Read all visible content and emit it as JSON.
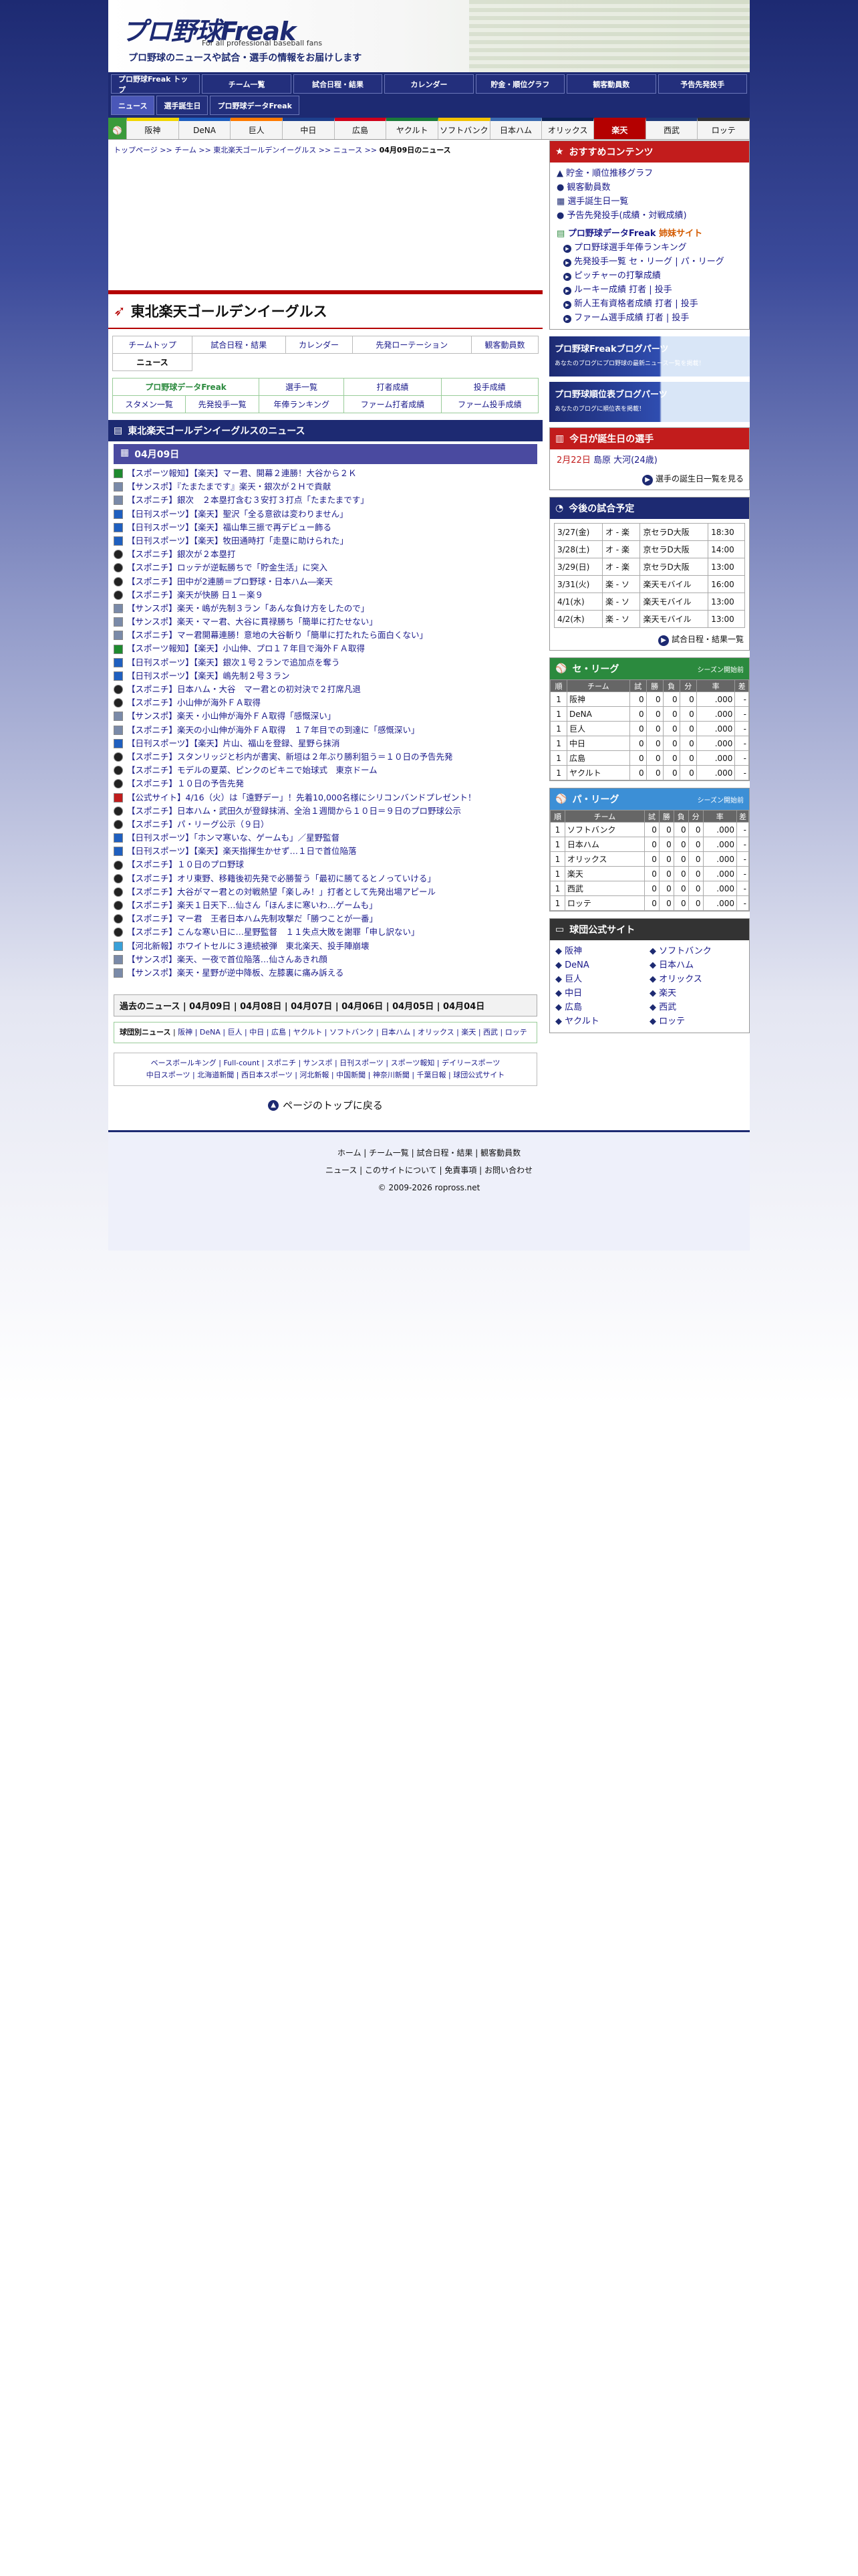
{
  "header": {
    "logo": "プロ野球Freak",
    "subtitle": "For all professional baseball fans",
    "tagline": "プロ野球のニュースや試合・選手の情報をお届けします"
  },
  "nav": {
    "row1": [
      "プロ野球Freak トップ",
      "チーム一覧",
      "試合日程・結果",
      "カレンダー",
      "貯金・順位グラフ",
      "観客動員数",
      "予告先発投手"
    ],
    "row2": [
      "ニュース",
      "選手誕生日",
      "プロ野球データFreak"
    ]
  },
  "teams": [
    "阪神",
    "DeNA",
    "巨人",
    "中日",
    "広島",
    "ヤクルト",
    "ソフトバンク",
    "日本ハム",
    "オリックス",
    "楽天",
    "西武",
    "ロッテ"
  ],
  "breadcrumb": {
    "path": "トップページ >> チーム >> 東北楽天ゴールデンイーグルス >> ニュース >> ",
    "current": "04月09日のニュース"
  },
  "page_title": "東北楽天ゴールデンイーグルス",
  "tabs": {
    "row1": [
      "チームトップ",
      "試合日程・結果",
      "カレンダー",
      "先発ローテーション",
      "観客動員数"
    ],
    "row2": [
      "ニュース"
    ],
    "row3": [
      "プロ野球データFreak",
      "選手一覧",
      "打者成績",
      "投手成績"
    ],
    "row4": [
      "スタメン一覧",
      "先発投手一覧",
      "年俸ランキング",
      "ファーム打者成績",
      "ファーム投手成績"
    ]
  },
  "news_section": "東北楽天ゴールデンイーグルスのニュース",
  "news_date": "04月09日",
  "news": [
    "【スポーツ報知】【楽天】マー君、開幕２連勝！大谷から２Ｋ",
    "【サンスポ】『たまたまです』楽天・銀次が２Ｈで貢献",
    "【スポニチ】銀次　２本塁打含む３安打３打点「たまたまです」",
    "【日刊スポーツ】【楽天】聖沢「全る意欲は変わりません」",
    "【日刊スポーツ】【楽天】福山隼三振で再デビュー飾る",
    "【日刊スポーツ】【楽天】牧田通時打「走塁に助けられた」",
    "【スポニチ】銀次が２本塁打",
    "【スポニチ】ロッテが逆転勝ちで「貯金生活」に突入",
    "【スポニチ】田中が2連勝＝プロ野球・日本ハム―楽天",
    "【スポニチ】楽天が快勝 日１－楽９",
    "【サンスポ】楽天・嶋が先制３ラン「あんな負け方をしたので」",
    "【サンスポ】楽天・マー君、大谷に貫禄勝ち「簡単に打たせない」",
    "【スポニチ】マー君開幕連勝！意地の大谷斬り「簡単に打たれたら面白くない」",
    "【スポーツ報知】【楽天】小山伸、プロ１７年目で海外ＦＡ取得",
    "【日刊スポーツ】【楽天】銀次１号２ランで追加点を奪う",
    "【日刊スポーツ】【楽天】嶋先制２号３ラン",
    "【スポニチ】日本ハム・大谷　マー君との初対決で２打席凡退",
    "【スポニチ】小山伸が海外ＦＡ取得",
    "【サンスポ】楽天・小山伸が海外ＦＡ取得「感慨深い」",
    "【スポニチ】楽天の小山伸が海外ＦＡ取得　１７年目での到達に「感慨深い」",
    "【日刊スポーツ】【楽天】片山、福山を登録、星野ら抹消",
    "【スポニチ】スタンリッジと杉内が書実、新垣は２年ぶり勝利狙う＝１０日の予告先発",
    "【スポニチ】モデルの夏菜、ピンクのビキニで始球式　東京ドーム",
    "【スポニチ】１０日の予告先発",
    "【公式サイト】4/16（火）は「遠野デー」！先着10,000名様にシリコンバンドプレゼント！",
    "【スポニチ】日本ハム・武田久が登録抹消、全治１週間から１０日＝９日のプロ野球公示",
    "【スポニチ】パ・リーグ公示（９日）",
    "【日刊スポーツ】「ホンマ寒いな、ゲームも」／星野監督",
    "【日刊スポーツ】【楽天】楽天指揮生かせず…１日で首位陥落",
    "【スポニチ】１０日のプロ野球",
    "【スポニチ】オリ東野、移籍後初先発で必勝誓う「最初に勝てるとノっていける」",
    "【スポニチ】大谷がマー君との対戦熱望「楽しみ！」打者として先発出場アピール",
    "【スポニチ】楽天１日天下…仙さん「ほんまに寒いわ…ゲームも」",
    "【スポニチ】マー君　王者日本ハム先制攻撃だ「勝つことが一番」",
    "【スポニチ】こんな寒い日に…星野監督　１１失点大敗を謝罪「申し訳ない」",
    "【河北新報】ホワイトセルに３連続被弾　東北楽天、投手陣崩壊",
    "【サンスポ】楽天、一夜で首位陥落…仙さんあきれ顔",
    "【サンスポ】楽天・星野が逆中降板、左膝裏に痛み訴える"
  ],
  "news_icons": [
    "G",
    "P",
    "P",
    "N",
    "N",
    "N",
    "S",
    "S",
    "S",
    "S",
    "P",
    "P",
    "P",
    "G",
    "N",
    "N",
    "S",
    "S",
    "P",
    "P",
    "N",
    "S",
    "S",
    "S",
    "K",
    "S",
    "S",
    "N",
    "N",
    "S",
    "S",
    "S",
    "S",
    "S",
    "S",
    "C",
    "P",
    "P"
  ],
  "past_news": "過去のニュース | 04月09日 | 04月08日 | 04月07日 | 04月06日 | 04月05日 | 04月04日",
  "team_links": {
    "label": "球団別ニュース",
    "items": "阪神 | DeNA | 巨人 | 中日 | 広島 | ヤクルト | ソフトバンク | 日本ハム | オリックス | 楽天 | 西武 | ロッテ"
  },
  "media_links": {
    "line1": "ベースボールキング | Full-count | スポニチ | サンスポ | 日刊スポーツ | スポーツ報知 | デイリースポーツ",
    "line2": "中日スポーツ | 北海道新聞 | 西日本スポーツ | 河北新報 | 中国新聞 | 神奈川新聞 | 千葉日報 | 球団公式サイト"
  },
  "back_to_top": "ページのトップに戻る",
  "side": {
    "recommend_title": "おすすめコンテンツ",
    "recommend": [
      "貯金・順位推移グラフ",
      "観客動員数",
      "選手誕生日一覧",
      "予告先発投手(成績・対戦成績)"
    ],
    "sister_site": "プロ野球データFreak",
    "sister_label": "姉妹サイト",
    "sister_items": [
      "プロ野球選手年俸ランキング",
      "先発投手一覧 セ・リーグ | パ・リーグ",
      "ピッチャーの打撃成績",
      "ルーキー成績 打者 | 投手",
      "新人王有資格者成績 打者 | 投手",
      "ファーム選手成績 打者 | 投手"
    ],
    "banner1": "プロ野球Freakブログパーツ",
    "banner1_sub": "あなたのブログにプロ野球の最新ニュース一覧を掲載！",
    "banner2": "プロ野球順位表ブログパーツ",
    "banner2_sub": "あなたのブログに順位表を掲載！",
    "birthday_title": "今日が誕生日の選手",
    "birthday_date": "2月22日",
    "birthday_name": "島原 大河(24歳)",
    "birthday_more": "選手の誕生日一覧を見る",
    "games_title": "今後の試合予定",
    "games": [
      {
        "date": "3/27(金)",
        "match": "オ - 楽",
        "place": "京セラD大阪",
        "time": "18:30"
      },
      {
        "date": "3/28(土)",
        "match": "オ - 楽",
        "place": "京セラD大阪",
        "time": "14:00"
      },
      {
        "date": "3/29(日)",
        "match": "オ - 楽",
        "place": "京セラD大阪",
        "time": "13:00"
      },
      {
        "date": "3/31(火)",
        "match": "楽 - ソ",
        "place": "楽天モバイル",
        "time": "16:00"
      },
      {
        "date": "4/1(水)",
        "match": "楽 - ソ",
        "place": "楽天モバイル",
        "time": "13:00"
      },
      {
        "date": "4/2(木)",
        "match": "楽 - ソ",
        "place": "楽天モバイル",
        "time": "13:00"
      }
    ],
    "games_more": "試合日程・結果一覧",
    "central_title": "セ・リーグ",
    "central_note": "シーズン開始前",
    "pacific_title": "パ・リーグ",
    "pacific_note": "シーズン開始前",
    "stand_headers": [
      "順",
      "チーム",
      "試",
      "勝",
      "負",
      "分",
      "率",
      "差"
    ],
    "central": [
      "阪神",
      "DeNA",
      "巨人",
      "中日",
      "広島",
      "ヤクルト"
    ],
    "pacific": [
      "ソフトバンク",
      "日本ハム",
      "オリックス",
      "楽天",
      "西武",
      "ロッテ"
    ],
    "official_title": "球団公式サイト",
    "official": [
      "阪神",
      "ソフトバンク",
      "DeNA",
      "日本ハム",
      "巨人",
      "オリックス",
      "中日",
      "楽天",
      "広島",
      "西武",
      "ヤクルト",
      "ロッテ"
    ]
  },
  "footer": {
    "line1": "ホーム | チーム一覧 | 試合日程・結果 | 観客動員数",
    "line2": "ニュース | このサイトについて | 免責事項 | お問い合わせ",
    "line3": "© 2009-2026 ropross.net"
  },
  "colors": {
    "navy": "#1d2a72",
    "red": "#b40000",
    "green": "#2b8a3e"
  }
}
